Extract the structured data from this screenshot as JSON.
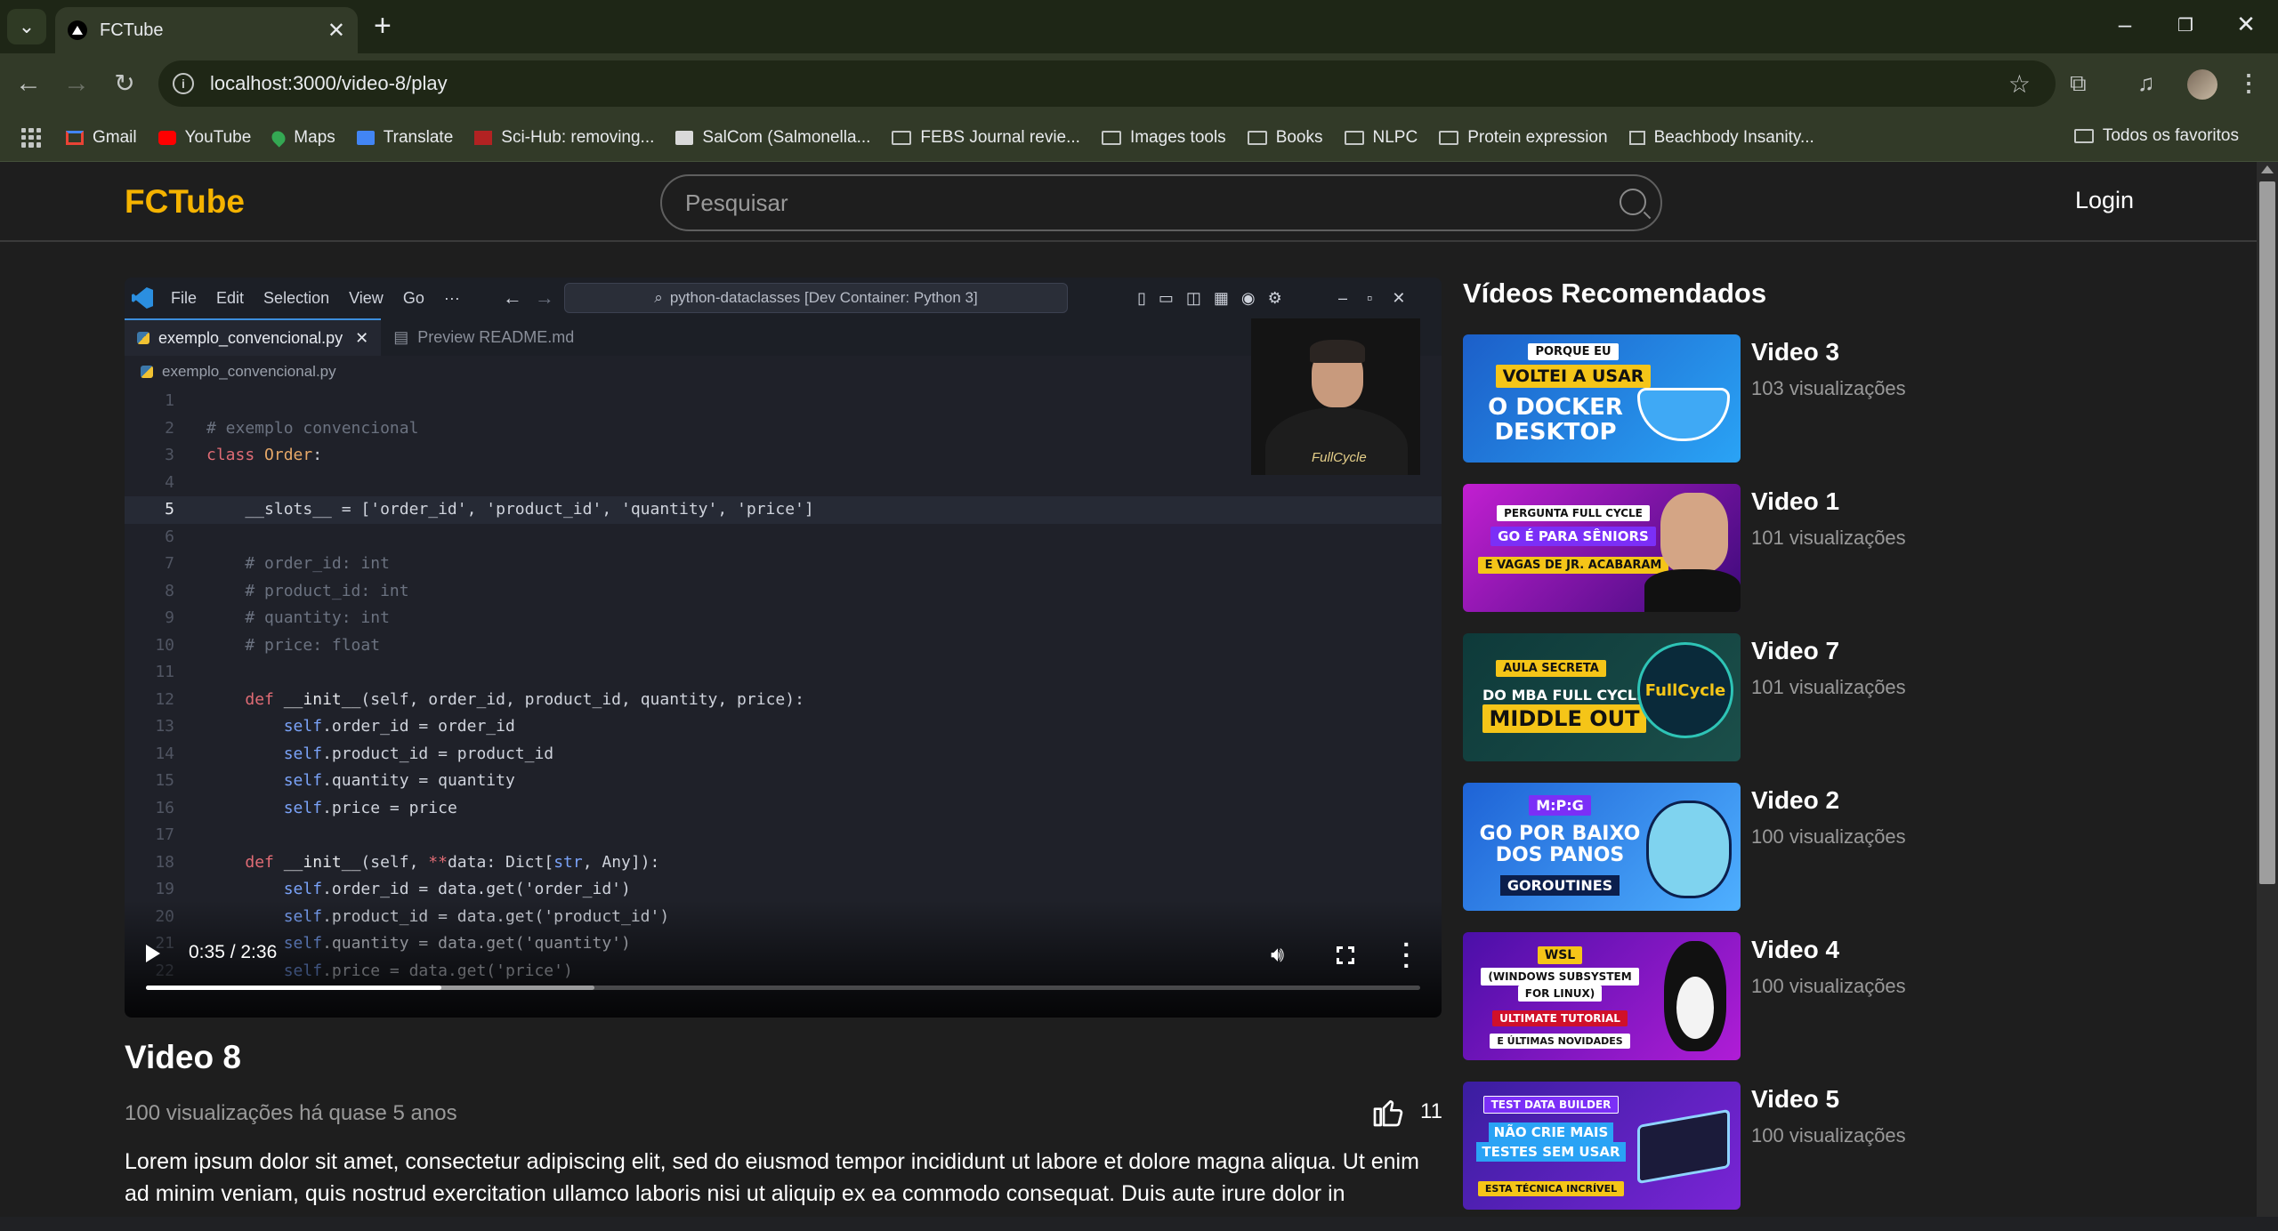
{
  "browser": {
    "tab_title": "FCTube",
    "url": "localhost:3000/video-8/play",
    "bookmarks": [
      "Gmail",
      "YouTube",
      "Maps",
      "Translate",
      "Sci-Hub: removing...",
      "SalCom (Salmonella...",
      "FEBS Journal revie...",
      "Images tools",
      "Books",
      "NLPC",
      "Protein expression",
      "Beachbody Insanity..."
    ],
    "all_bookmarks": "Todos os favoritos"
  },
  "header": {
    "logo": "FCTube",
    "search_placeholder": "Pesquisar",
    "login": "Login"
  },
  "player": {
    "editor": {
      "menu": [
        "File",
        "Edit",
        "Selection",
        "View",
        "Go",
        "···"
      ],
      "command_center": "python-dataclasses [Dev Container: Python 3]",
      "tabs": [
        "exemplo_convencional.py",
        "Preview README.md"
      ],
      "breadcrumb": "exemplo_convencional.py",
      "line_numbers": [
        "1",
        "2",
        "3",
        "4",
        "5",
        "6",
        "7",
        "8",
        "9",
        "10",
        "11",
        "12",
        "13",
        "14",
        "15",
        "16",
        "17",
        "18",
        "19",
        "20",
        "21",
        "22"
      ],
      "webcam_brand": "FullCycle"
    },
    "time": "0:35 / 2:36",
    "played_fraction": 0.232,
    "buffered_fraction": 0.352
  },
  "video": {
    "title": "Video 8",
    "meta": "100 visualizações há quase 5 anos",
    "likes": "11",
    "description": "Lorem ipsum dolor sit amet, consectetur adipiscing elit, sed do eiusmod tempor incididunt ut labore et dolore magna aliqua. Ut enim ad minim veniam, quis nostrud exercitation ullamco laboris nisi ut aliquip ex ea commodo consequat. Duis aute irure dolor in"
  },
  "recommended": {
    "title": "Vídeos Recomendados",
    "items": [
      {
        "name": "Video 3",
        "views": "103 visualizações",
        "thumb_lines": [
          "PORQUE EU",
          "VOLTEI A USAR",
          "O DOCKER",
          "DESKTOP"
        ]
      },
      {
        "name": "Video 1",
        "views": "101 visualizações",
        "thumb_lines": [
          "PERGUNTA FULL CYCLE",
          "GO É PARA SÊNIORS",
          "E VAGAS DE JR. ACABARAM"
        ]
      },
      {
        "name": "Video 7",
        "views": "101 visualizações",
        "thumb_lines": [
          "AULA SECRETA",
          "DO MBA FULL CYCLE",
          "MIDDLE OUT",
          "FullCycle"
        ]
      },
      {
        "name": "Video 2",
        "views": "100 visualizações",
        "thumb_lines": [
          "M:P:G",
          "GO POR BAIXO",
          "DOS PANOS",
          "GOROUTINES"
        ]
      },
      {
        "name": "Video 4",
        "views": "100 visualizações",
        "thumb_lines": [
          "WSL",
          "(WINDOWS SUBSYSTEM",
          "FOR LINUX)",
          "ULTIMATE TUTORIAL",
          "E ÚLTIMAS NOVIDADES"
        ]
      },
      {
        "name": "Video 5",
        "views": "100 visualizações",
        "thumb_lines": [
          "TEST DATA BUILDER",
          "NÃO CRIE MAIS",
          "TESTES SEM USAR",
          "ESTA TÉCNICA INCRÍVEL"
        ]
      }
    ]
  }
}
